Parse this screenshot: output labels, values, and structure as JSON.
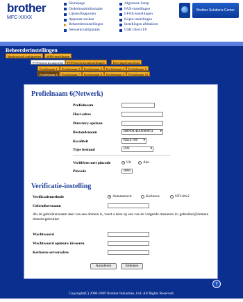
{
  "header": {
    "brand": "brother",
    "model": "MFC-XXXX",
    "nav_left": [
      "Homepage",
      "Onderhoudsinformatie",
      "Lijsten/Rapporten",
      "Apparaat zoeken",
      "Beheerdersinstellingen",
      "Netwerkconfiguratie"
    ],
    "nav_right": [
      "Algemene Setup",
      "FAX-instellingen",
      "I-FAX-instellingen",
      "Kopie-instellingen",
      "Instellingen afdrukken",
      "USB Direct I/F"
    ],
    "solutions_center": "Brother Solutions Center"
  },
  "admin": {
    "title": "Beheerderinstellingen",
    "tabs_row1": [
      "Wachtwoord configureren",
      "WEB-instellingen"
    ],
    "tabs_row2": [
      "FTP/netwerkscanprofiel",
      "FTP/netwerkscaninstellingen",
      "Beveiligd functieslot"
    ],
    "profiles_row1": [
      "Profielnaam 1",
      "Profielnaam 2",
      "Profielnaam 3",
      "Profielnaam 4",
      "Profielnaam 5"
    ],
    "profiles_row2": [
      "Profielnaam 6",
      "Profielnaam 7",
      "Profielnaam 8",
      "Profielnaam 9",
      "Profielnaam 10"
    ]
  },
  "form": {
    "heading": "Profielnaam 6(Netwerk)",
    "fields": {
      "profielnaam": "Profielnaam",
      "host": "Host-adres",
      "directory": "Directory opslaan",
      "bestandsnaam": "Bestandsnaam",
      "bestandsnaam_value": "BRN001BA9000954",
      "kwaliteit": "Kwaliteit",
      "kwaliteit_value": "Kleur 100",
      "type": "Type bestand",
      "type_value": "PDF",
      "pincode_verify": "Verifiëren met pincode",
      "uit": "Uit",
      "aan": "Aan",
      "pincode": "Pincode",
      "pincode_value": "0000"
    }
  },
  "verification": {
    "heading": "Verificatie-instelling",
    "method_label": "Verificatiemethode",
    "options": [
      "Automatisch",
      "Kerberos",
      "NTLMv2"
    ],
    "username_label": "Gebruikersnaam",
    "note": "Als de gebruikersnaam deel van een domein is, voert u deze op een van de volgende manieren in: gebruiker@domein domein\\gebruiker",
    "password_label": "Wachtwoord",
    "password_confirm_label": "Wachtwoord opnieuw invoeren",
    "kerberos_label": "Kerberos-serveradres",
    "cancel": "Annuleren",
    "submit": "Indienen"
  },
  "footer": "Copyright(C) 2000-2009 Brother Industries, Ltd. All Rights Reserved."
}
